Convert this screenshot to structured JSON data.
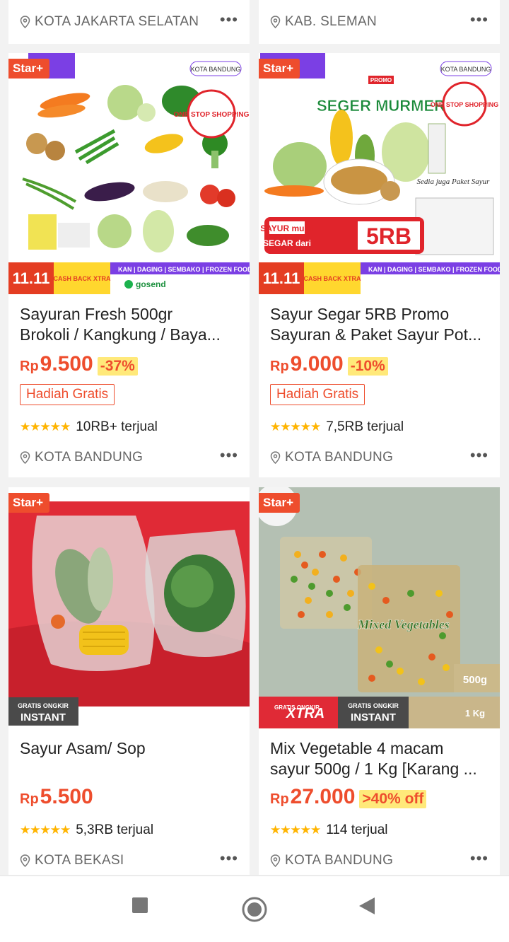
{
  "top_cards": [
    {
      "location": "KOTA JAKARTA SELATAN"
    },
    {
      "location": "KAB. SLEMAN"
    }
  ],
  "products": [
    {
      "badge": "Star+",
      "title_line1": "Sayuran Fresh 500gr",
      "title_line2": "Brokoli / Kangkung / Baya...",
      "currency": "Rp",
      "price": "9.500",
      "discount": "-37%",
      "gift": "Hadiah Gratis",
      "sold": "10RB+ terjual",
      "location": "KOTA BANDUNG",
      "image": {
        "tag": "KOTA BANDUNG",
        "stamp": "ONE STOP SHOPPING",
        "event": "11.11",
        "cashback": "CASH BACK XTRA",
        "strip": "KAN | DAGING | SEMBAKO | FROZEN FOOD",
        "partner": "gosend"
      }
    },
    {
      "badge": "Star+",
      "title_line1": "Sayur Segar 5RB Promo",
      "title_line2": "Sayuran & Paket Sayur Pot...",
      "currency": "Rp",
      "price": "9.000",
      "discount": "-10%",
      "gift": "Hadiah Gratis",
      "sold": "7,5RB terjual",
      "location": "KOTA BANDUNG",
      "image": {
        "tag": "KOTA BANDUNG",
        "stamp": "ONE STOP SHOPPING",
        "brand_top": "PROMO",
        "brand": "SEGER MURMER",
        "sayur": "SAYUR mulai",
        "segar": "SEGAR dari",
        "price_tag": "5RB",
        "note": "Sedia juga Paket Sayur",
        "event": "11.11",
        "cashback": "CASH BACK XTRA",
        "strip": "KAN | DAGING | SEMBAKO | FROZEN FOOD"
      }
    },
    {
      "badge": "Star+",
      "title_line1": "Sayur Asam/ Sop",
      "title_line2": "",
      "currency": "Rp",
      "price": "5.500",
      "discount": "",
      "gift": "",
      "sold": "5,3RB terjual",
      "location": "KOTA BEKASI",
      "image": {
        "ongkir_top": "GRATIS ONGKIR",
        "ongkir_bottom": "INSTANT"
      }
    },
    {
      "badge": "Star+",
      "title_line1": "Mix Vegetable 4 macam",
      "title_line2": "sayur 500g / 1 Kg [Karang ...",
      "currency": "Rp",
      "price": "27.000",
      "discount": ">40% off",
      "gift": "",
      "sold": "114 terjual",
      "location": "KOTA BANDUNG",
      "image": {
        "pack_label": "Mixed Vegetables",
        "weight1": "500g",
        "weight2": "1 Kg",
        "xtra_top": "GRATIS ONGKIR",
        "xtra": "XTRA",
        "ongkir_top": "GRATIS ONGKIR",
        "ongkir_bottom": "INSTANT"
      }
    }
  ],
  "colors": {
    "accent": "#ee4d2d",
    "star": "#ffb400",
    "discount_bg": "#ffe97a"
  },
  "nav": {
    "icons": [
      "recents-square-icon",
      "home-circle-icon",
      "back-triangle-icon"
    ]
  }
}
